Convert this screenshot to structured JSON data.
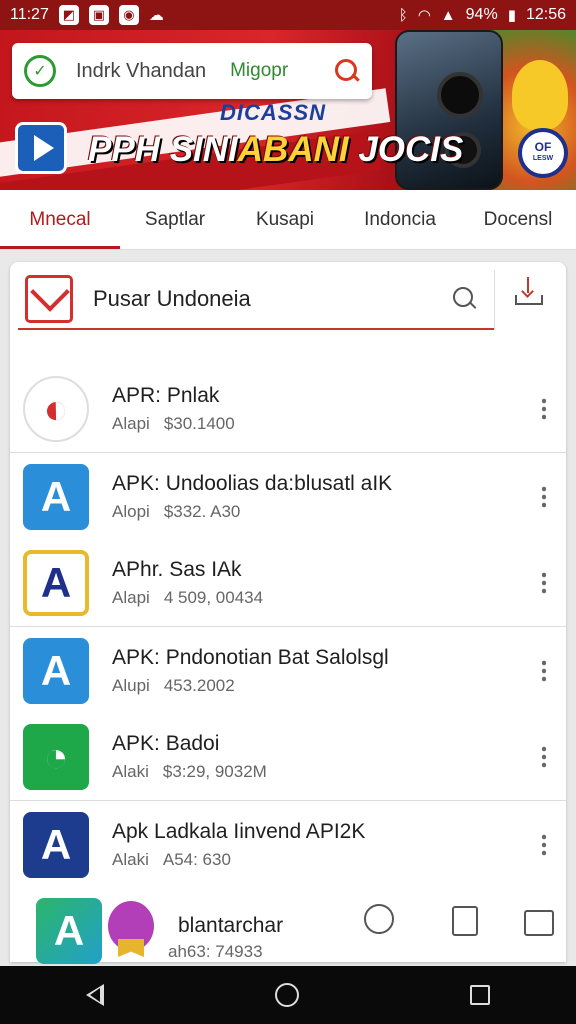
{
  "status_bar": {
    "time_left": "11:27",
    "battery": "94%",
    "time_right": "12:56",
    "bg_color": "#8e1414"
  },
  "banner": {
    "search_placeholder": "Indrk Vhandan",
    "search_secondary": "Migopr",
    "promo_small": "DICASSN",
    "promo_big_white": "PPH SINI",
    "promo_big_yellow": "ABANI",
    "promo_big_end": "JOCIS",
    "badge_line1": "OF",
    "badge_line2": "LESW",
    "icons": [
      "brand-badge-icon",
      "search-icon",
      "play-icon"
    ]
  },
  "tabs": [
    {
      "label": "Mnecal",
      "active": true
    },
    {
      "label": "Saptlar",
      "active": false
    },
    {
      "label": "Kusapi",
      "active": false
    },
    {
      "label": "Indoncia",
      "active": false
    },
    {
      "label": "Docensl",
      "active": false
    }
  ],
  "card_search": {
    "query": "Pusar Undoneia",
    "icons": [
      "mail-icon",
      "search-icon",
      "download-icon"
    ]
  },
  "apps": [
    {
      "title": "APR: Pnlak",
      "label": "Alapi",
      "value": "$30.1400",
      "icon": "red-round-icon"
    },
    {
      "title": "APK: Undoolias da:blusatl aIK",
      "label": "Alopi",
      "value": "$332. A30",
      "icon": "blue-a-icon"
    },
    {
      "title": "APhr. Sas IAk",
      "label": "Alapi",
      "value": "4 509, 00434",
      "icon": "framed-a-icon"
    },
    {
      "title": "APK: Pndonotian Bat Salolsgl",
      "label": "Alupi",
      "value": "453.2002",
      "icon": "blue-a-icon"
    },
    {
      "title": "APK: Badoi",
      "label": "Alaki",
      "value": "$3:29, 9032M",
      "icon": "green-chat-icon"
    },
    {
      "title": "Apk Ladkala Iinvend API2K",
      "label": "Alaki",
      "value": "A54: 630",
      "icon": "navy-a-icon"
    }
  ],
  "mini_nav": {
    "label": "blantarchar",
    "sub": "ah63: 74933",
    "icons": [
      "teal-a-icon",
      "badge-icon",
      "user-icon",
      "card-icon",
      "window-icon"
    ]
  },
  "system_nav": {
    "icons": [
      "back-icon",
      "home-icon",
      "recents-icon"
    ]
  },
  "colors": {
    "accent_red": "#b11b1b",
    "green": "#2f9a33"
  }
}
